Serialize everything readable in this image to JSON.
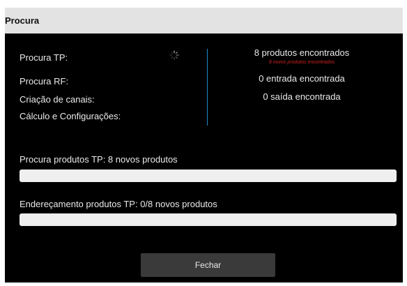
{
  "dialog": {
    "title": "Procura",
    "steps": {
      "procura_tp": "Procura TP:",
      "procura_rf": "Procura RF:",
      "criacao_canais": "Criação de canais:",
      "calculo_config": "Cálculo e Configurações:"
    },
    "results": {
      "products_found": "8 produtos encontrados",
      "new_products_found": "8 novos produtos encontrados",
      "inputs_found": "0 entrada encontrada",
      "outputs_found": "0 saída encontrada"
    },
    "progress": {
      "search_label": "Procura produtos TP: 8 novos produtos",
      "search_fraction": 0,
      "addressing_label": "Endereçamento produtos TP: 0/8 novos produtos",
      "addressing_fraction": 0
    },
    "close_button": "Fechar"
  },
  "colors": {
    "titlebar": "#e3e3e3",
    "background": "#000000",
    "divider": "#1e88c8",
    "highlight_text": "#cc2222",
    "progress_track": "#efefef",
    "button": "#3a3a3a"
  },
  "icons": {
    "loading": "spinner-icon"
  }
}
